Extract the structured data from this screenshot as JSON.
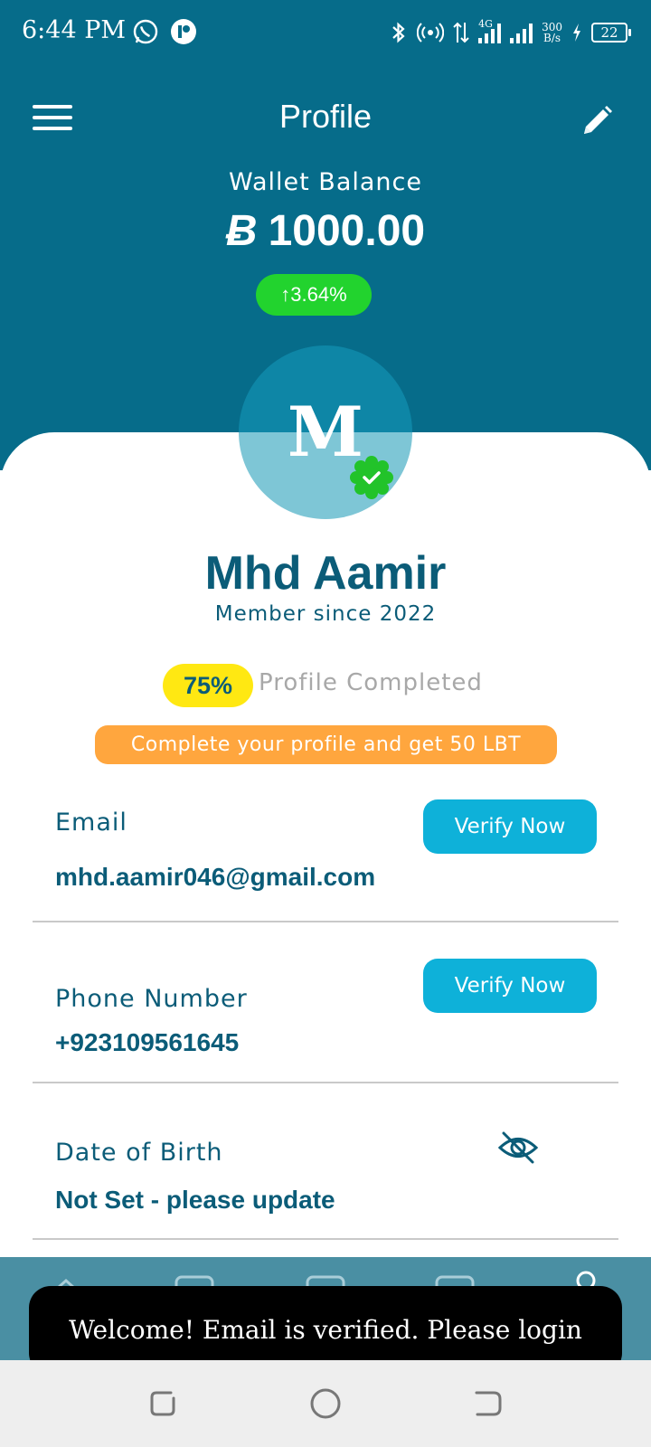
{
  "status_bar": {
    "time": "6:44 PM",
    "network": "4G",
    "speed_value": "300",
    "speed_unit": "B/s",
    "battery": "22"
  },
  "header": {
    "title": "Profile",
    "menu_icon": "hamburger-menu-icon",
    "edit_icon": "pencil-icon"
  },
  "wallet": {
    "label": "Wallet Balance",
    "currency_symbol": "Ƀ",
    "amount": "1000.00",
    "change": "↑3.64%",
    "change_color": "#22d32e"
  },
  "user": {
    "initial": "M",
    "name": "Mhd Aamir",
    "member_since": "Member since 2022"
  },
  "profile_completion": {
    "percent": "75%",
    "label": "Profile Completed",
    "reward_text": "Complete your profile and get 50 LBT"
  },
  "fields": {
    "email": {
      "label": "Email",
      "value": "mhd.aamir046@gmail.com",
      "button": "Verify Now"
    },
    "phone": {
      "label": "Phone Number",
      "value": "+923109561645",
      "button": "Verify Now"
    },
    "dob": {
      "label": "Date of Birth",
      "value": "Not Set - please update"
    }
  },
  "toast": {
    "message": "Welcome! Email is verified. Please login"
  },
  "colors": {
    "primary": "#066c8a",
    "text": "#0b5c78",
    "accent_button": "#0eb1d9",
    "badge_yellow": "#ffe812",
    "reward_orange": "#ffa63e"
  }
}
